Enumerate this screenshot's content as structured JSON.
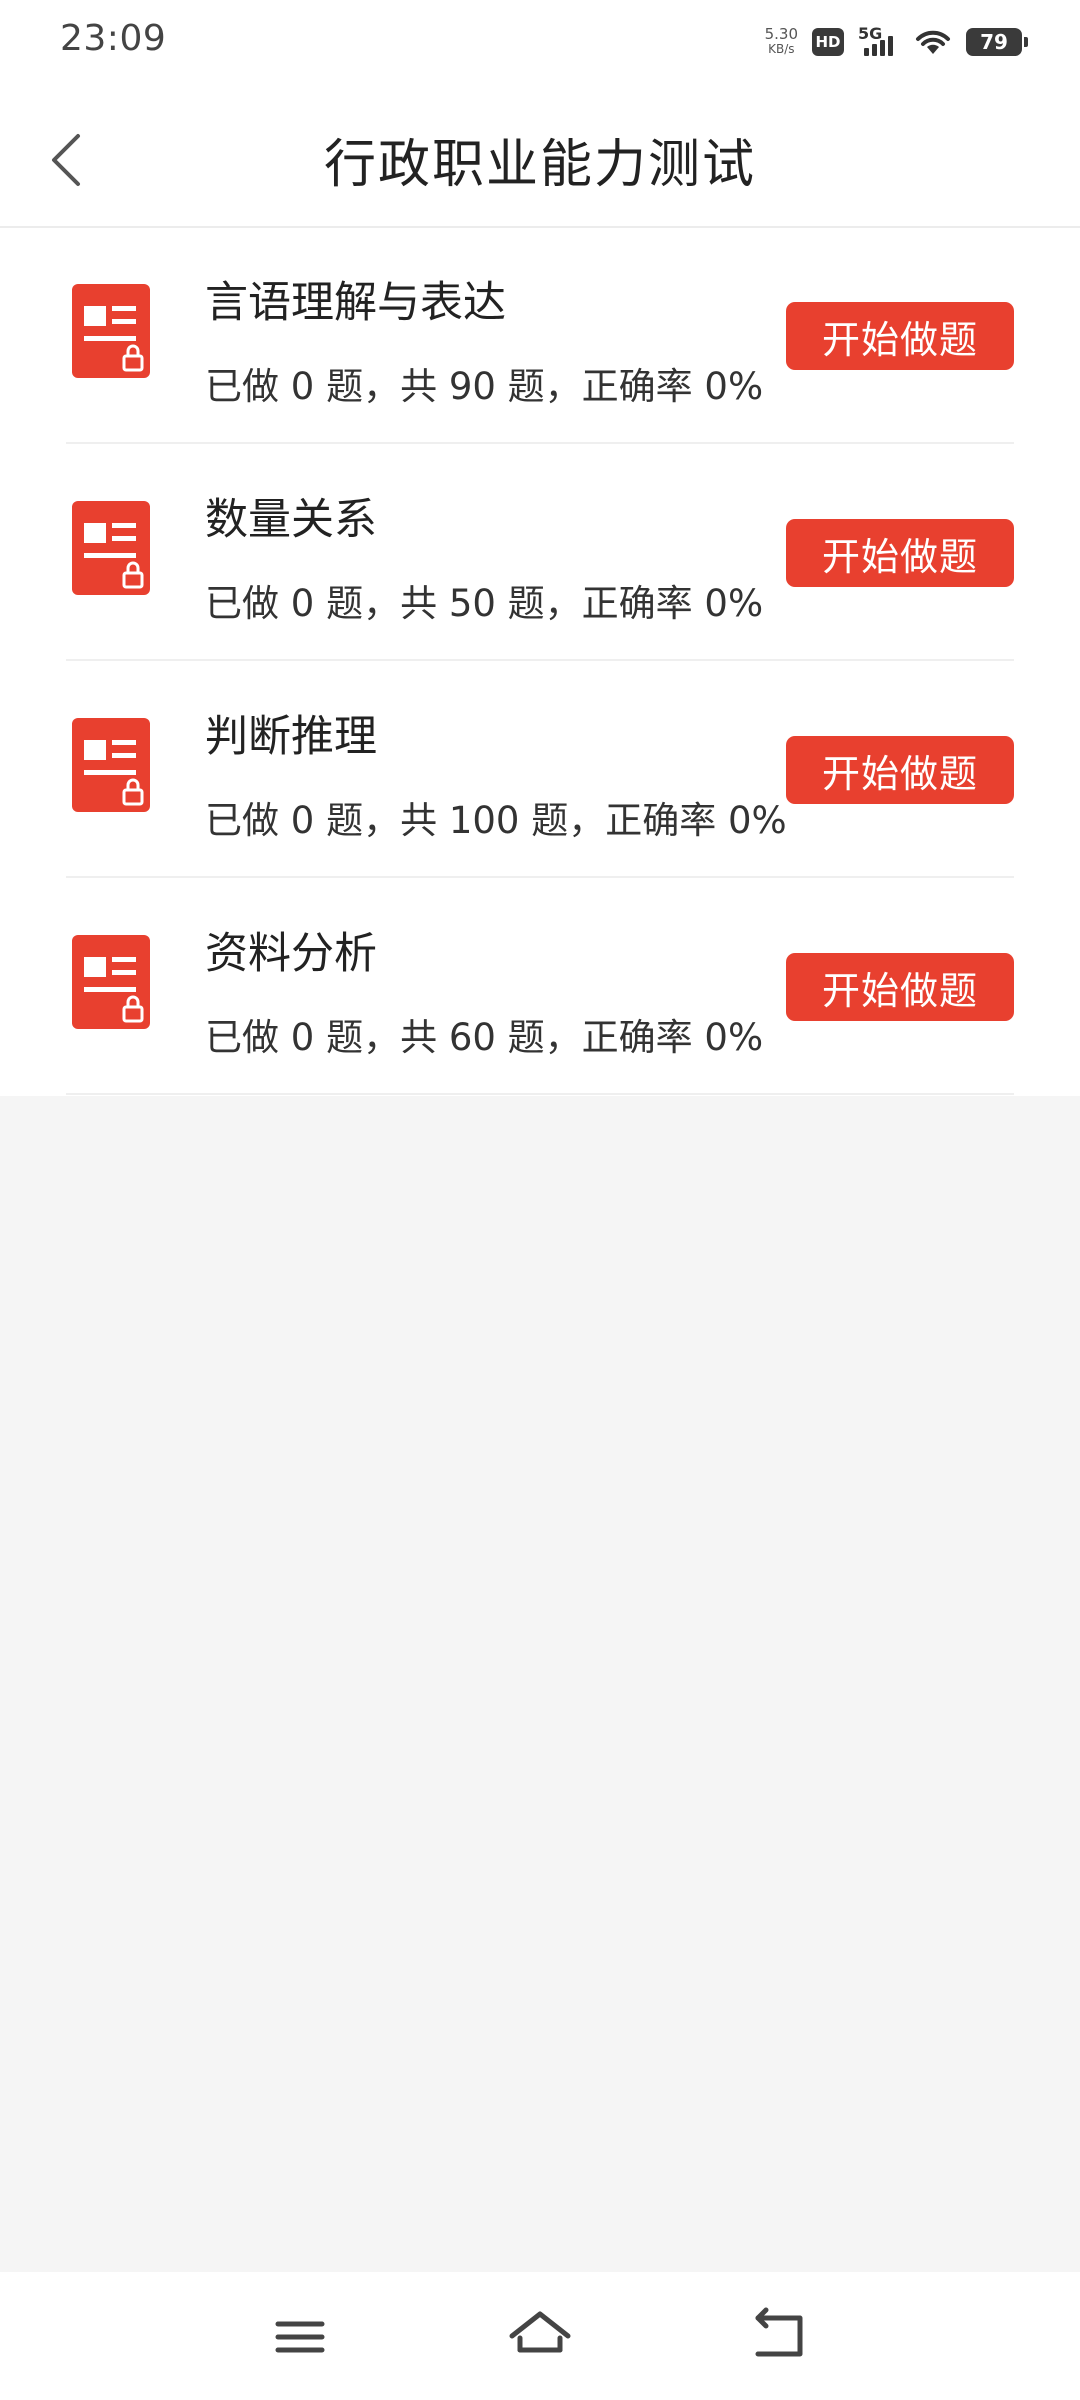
{
  "status_bar": {
    "time": "23:09",
    "net_speed_value": "5.30",
    "net_speed_unit": "KB/s",
    "hd": "HD",
    "network": "5G",
    "battery": "79"
  },
  "header": {
    "back_icon": "chevron-left-icon",
    "title": "行政职业能力测试"
  },
  "exams": [
    {
      "name": "言语理解与表达",
      "stats": "已做 0 题，共 90 题，正确率 0%",
      "button": "开始做题"
    },
    {
      "name": "数量关系",
      "stats": "已做 0 题，共 50 题，正确率 0%",
      "button": "开始做题"
    },
    {
      "name": "判断推理",
      "stats": "已做 0 题，共 100 题，正确率 0%",
      "button": "开始做题"
    },
    {
      "name": "资料分析",
      "stats": "已做 0 题，共 60 题，正确率 0%",
      "button": "开始做题"
    }
  ],
  "nav_bar": {
    "menu_icon": "menu-icon",
    "home_icon": "home-icon",
    "back_icon": "back-icon"
  },
  "colors": {
    "accent": "#e8402f",
    "background": "#f5f5f5",
    "surface": "#ffffff"
  }
}
